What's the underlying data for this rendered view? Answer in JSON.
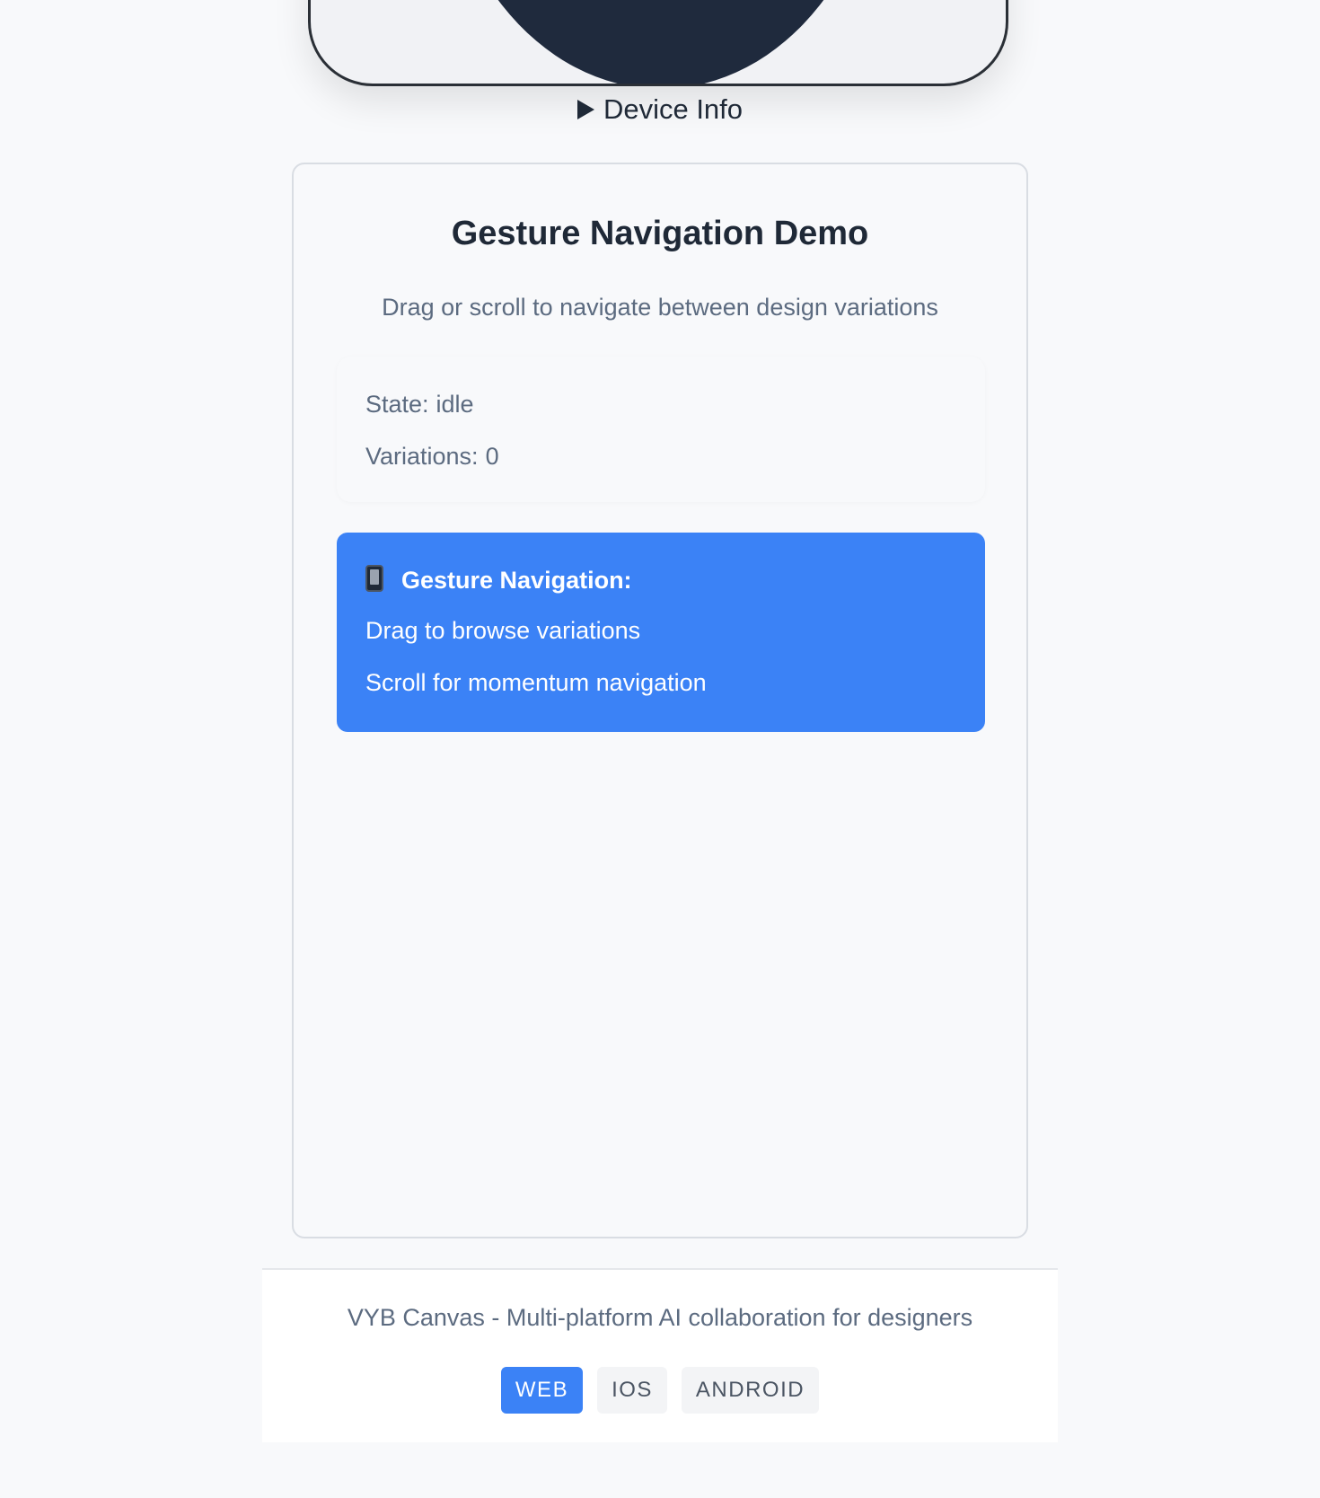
{
  "device": {
    "info_label": "Device Info"
  },
  "demo": {
    "title": "Gesture Navigation Demo",
    "subtitle": "Drag or scroll to navigate between design variations",
    "state_label": "State:",
    "state_value": "idle",
    "variations_label": "Variations:",
    "variations_value": "0"
  },
  "info_panel": {
    "icon": "mobile-phone-icon",
    "heading": "Gesture Navigation:",
    "lines": [
      "Drag to browse variations",
      "Scroll for momentum navigation"
    ],
    "background_color": "#3b82f6"
  },
  "footer": {
    "text": "VYB Canvas - Multi-platform AI collaboration for designers",
    "platforms": [
      {
        "label": "WEB",
        "active": true
      },
      {
        "label": "IOS",
        "active": false
      },
      {
        "label": "ANDROID",
        "active": false
      }
    ]
  }
}
